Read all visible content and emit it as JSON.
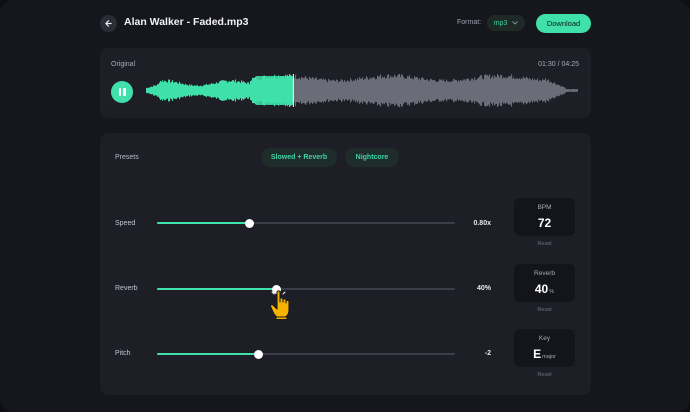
{
  "header": {
    "title": "Alan Walker - Faded.mp3",
    "format_label": "Format:",
    "format_value": "mp3",
    "download_label": "Download"
  },
  "player": {
    "label": "Original",
    "time": "01:30 / 04:25",
    "progress": 0.34
  },
  "presets": {
    "label": "Presets",
    "items": [
      "Slowed + Reverb",
      "Nightcore"
    ]
  },
  "sliders": [
    {
      "label": "Speed",
      "value": "0.80x",
      "level": 0.31
    },
    {
      "label": "Reverb",
      "value": "40%",
      "level": 0.4
    },
    {
      "label": "Pitch",
      "value": "-2",
      "level": 0.34
    }
  ],
  "stats": [
    {
      "title": "BPM",
      "value": "72",
      "unit": "",
      "reset": "Reset"
    },
    {
      "title": "Reverb",
      "value": "40",
      "unit": "%",
      "reset": "Reset"
    },
    {
      "title": "Key",
      "value": "E",
      "unit": "major",
      "reset": "Reset"
    }
  ],
  "colors": {
    "accent": "#3fe0aa",
    "background": "#16171c",
    "panel": "#1e1f26"
  }
}
